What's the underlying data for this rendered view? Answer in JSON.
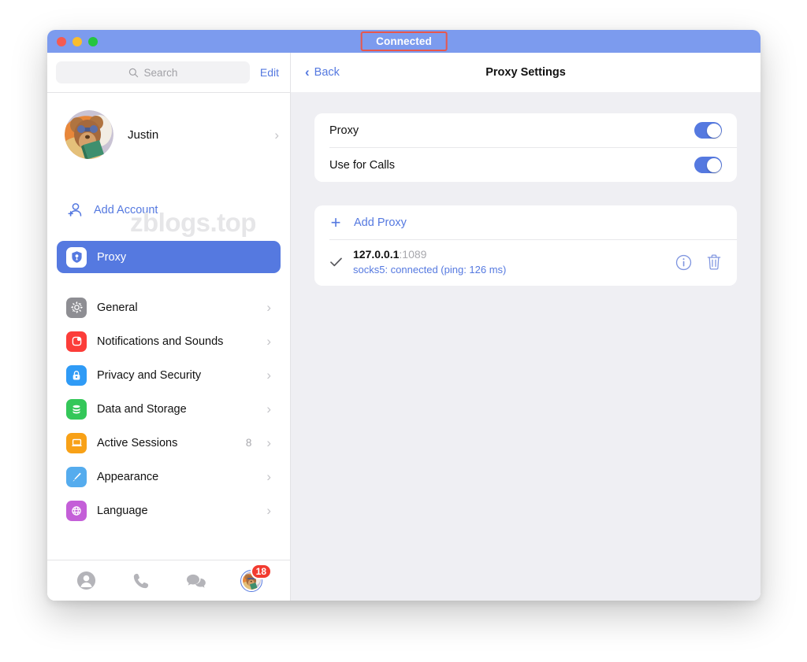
{
  "window": {
    "status_text": "Connected",
    "traffic_lights": [
      "close-button",
      "minimize-button",
      "maximize-button"
    ],
    "titlebar_color": "#7C9BEE",
    "status_highlight_color": "#E8574C"
  },
  "sidebar": {
    "search": {
      "placeholder": "Search",
      "icon": "search-icon"
    },
    "edit_label": "Edit",
    "profile": {
      "name": "Justin",
      "avatar": "user-avatar",
      "chevron": "›"
    },
    "watermark": "zblogs.top",
    "add_account": {
      "label": "Add Account",
      "icon": "person-plus-icon"
    },
    "selected_item": {
      "label": "Proxy",
      "icon": "shield-icon",
      "color": "#5579E0"
    },
    "settings": [
      {
        "label": "General",
        "icon": "gear-icon",
        "color": "#8E8E93",
        "count": ""
      },
      {
        "label": "Notifications and Sounds",
        "icon": "notification-icon",
        "color": "#FC3D39",
        "count": ""
      },
      {
        "label": "Privacy and Security",
        "icon": "lock-icon",
        "color": "#2F9BF6",
        "count": ""
      },
      {
        "label": "Data and Storage",
        "icon": "database-icon",
        "color": "#34C759",
        "count": ""
      },
      {
        "label": "Active Sessions",
        "icon": "laptop-icon",
        "color": "#F8A117",
        "count": "8"
      },
      {
        "label": "Appearance",
        "icon": "brush-icon",
        "color": "#55ACEE",
        "count": ""
      },
      {
        "label": "Language",
        "icon": "globe-icon",
        "color": "#C45FD8",
        "count": ""
      }
    ],
    "tabs": [
      {
        "name": "contacts-tab",
        "icon": "person-icon"
      },
      {
        "name": "calls-tab",
        "icon": "phone-icon"
      },
      {
        "name": "chats-tab",
        "icon": "chat-bubbles-icon"
      },
      {
        "name": "settings-tab",
        "icon": "user-avatar",
        "badge": "18"
      }
    ]
  },
  "main": {
    "back_label": "Back",
    "back_icon": "chevron-left-icon",
    "title": "Proxy Settings",
    "toggles": [
      {
        "label": "Proxy",
        "state": "on"
      },
      {
        "label": "Use for Calls",
        "state": "on"
      }
    ],
    "add_proxy": {
      "label": "Add Proxy",
      "icon": "plus-icon"
    },
    "proxies": [
      {
        "selected": true,
        "check_icon": "checkmark-icon",
        "host": "127.0.0.1",
        "port": ":1089",
        "status": "socks5: connected (ping: 126 ms)",
        "info_icon": "info-circle-icon",
        "delete_icon": "trash-icon"
      }
    ]
  }
}
